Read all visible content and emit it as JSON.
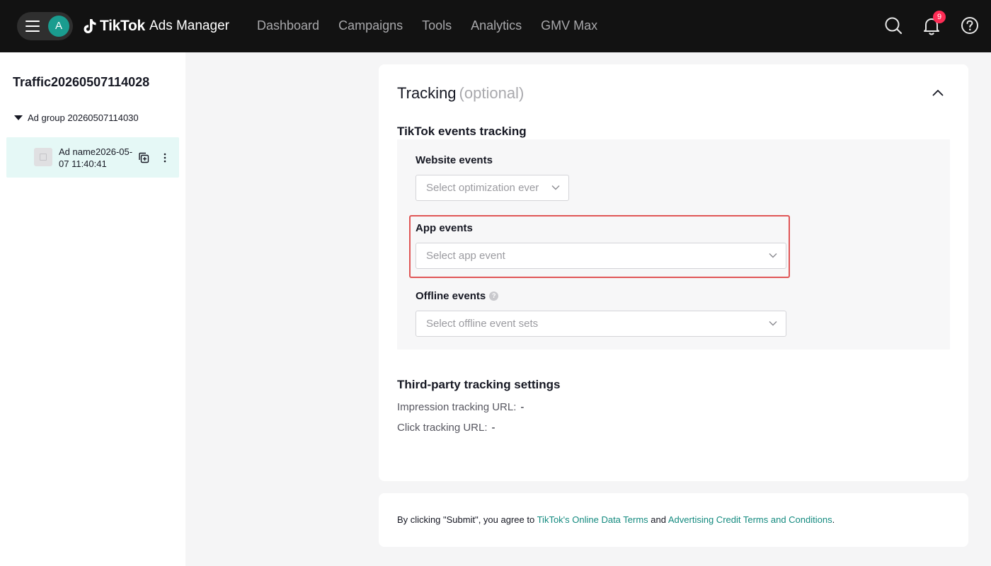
{
  "app": {
    "brand": "TikTok",
    "product": "Ads Manager",
    "avatar_initial": "A",
    "notification_count": "9",
    "accent_color": "#1a9c8f",
    "link_color": "#138a7f",
    "highlight_color": "#e05656"
  },
  "nav": {
    "items": [
      "Dashboard",
      "Campaigns",
      "Tools",
      "Analytics",
      "GMV Max"
    ]
  },
  "header_icons": [
    "menu-icon",
    "search-icon",
    "bell-icon",
    "help-icon"
  ],
  "sidebar": {
    "campaign": "Traffic20260507114028",
    "ad_group": "Ad group 20260507114030",
    "ad_name": "Ad name2026-05-07 11:40:41"
  },
  "tracking": {
    "title": "Tracking",
    "optional": "(optional)",
    "events_heading": "TikTok events tracking",
    "website_events_label": "Website events",
    "website_events_placeholder": "Select optimization ever",
    "app_events_label": "App events",
    "app_events_placeholder": "Select app event",
    "offline_events_label": "Offline events",
    "offline_events_placeholder": "Select offline event sets",
    "third_party_heading": "Third-party tracking settings",
    "impression_label": "Impression tracking URL:",
    "impression_value": "-",
    "click_label": "Click tracking URL:",
    "click_value": "-"
  },
  "submit": {
    "prefix": "By clicking \"Submit\", you agree to ",
    "link1": "TikTok's Online Data Terms",
    "middle": " and ",
    "link2": "Advertising Credit Terms and Conditions",
    "suffix": "."
  }
}
